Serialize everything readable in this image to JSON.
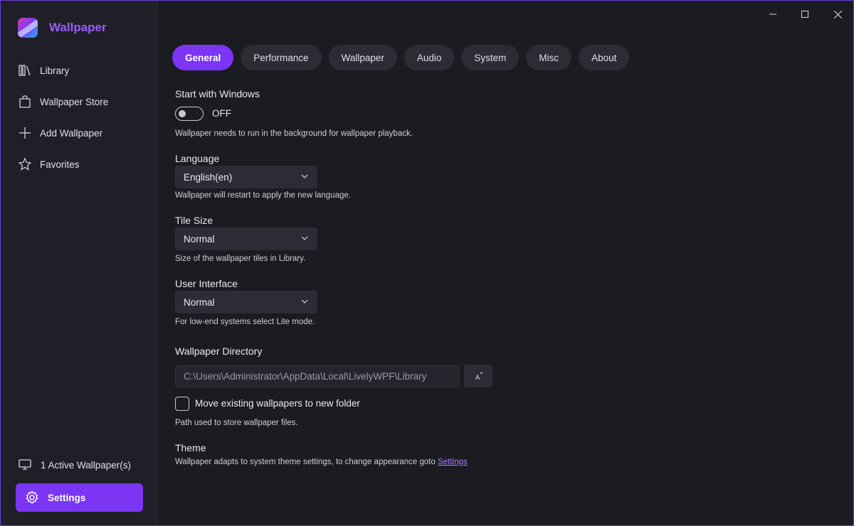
{
  "app": {
    "name": "Wallpaper",
    "accent": "#7b35f3",
    "brand_color": "#9d5cff"
  },
  "sidebar": {
    "items": [
      {
        "label": "Library",
        "icon": "library-icon"
      },
      {
        "label": "Wallpaper Store",
        "icon": "store-bag-icon"
      },
      {
        "label": "Add Wallpaper",
        "icon": "plus-icon"
      },
      {
        "label": "Favorites",
        "icon": "star-icon"
      }
    ],
    "active_wallpapers": "1 Active Wallpaper(s)",
    "settings": "Settings"
  },
  "tabs": [
    "General",
    "Performance",
    "Wallpaper",
    "Audio",
    "System",
    "Misc",
    "About"
  ],
  "active_tab": "General",
  "general": {
    "start_with_windows": {
      "title": "Start with Windows",
      "state": "OFF",
      "hint": "Wallpaper needs to run in the background for wallpaper playback."
    },
    "language": {
      "title": "Language",
      "value": "English(en)",
      "hint": "Wallpaper will restart to apply the new language."
    },
    "tile_size": {
      "title": "Tile Size",
      "value": "Normal",
      "hint": "Size of the wallpaper tiles in Library."
    },
    "user_interface": {
      "title": "User Interface",
      "value": "Normal",
      "hint": "For low-end systems select Lite mode."
    },
    "directory": {
      "title": "Wallpaper Directory",
      "path": "C:\\Users\\Administrator\\AppData\\Local\\LivelyWPF\\Library",
      "move_label": "Move existing wallpapers to new folder",
      "move_checked": false,
      "hint": "Path used to store wallpaper files."
    },
    "theme": {
      "title": "Theme",
      "hint": "Wallpaper adapts to system theme settings, to change appearance goto ",
      "link": "Settings"
    }
  }
}
